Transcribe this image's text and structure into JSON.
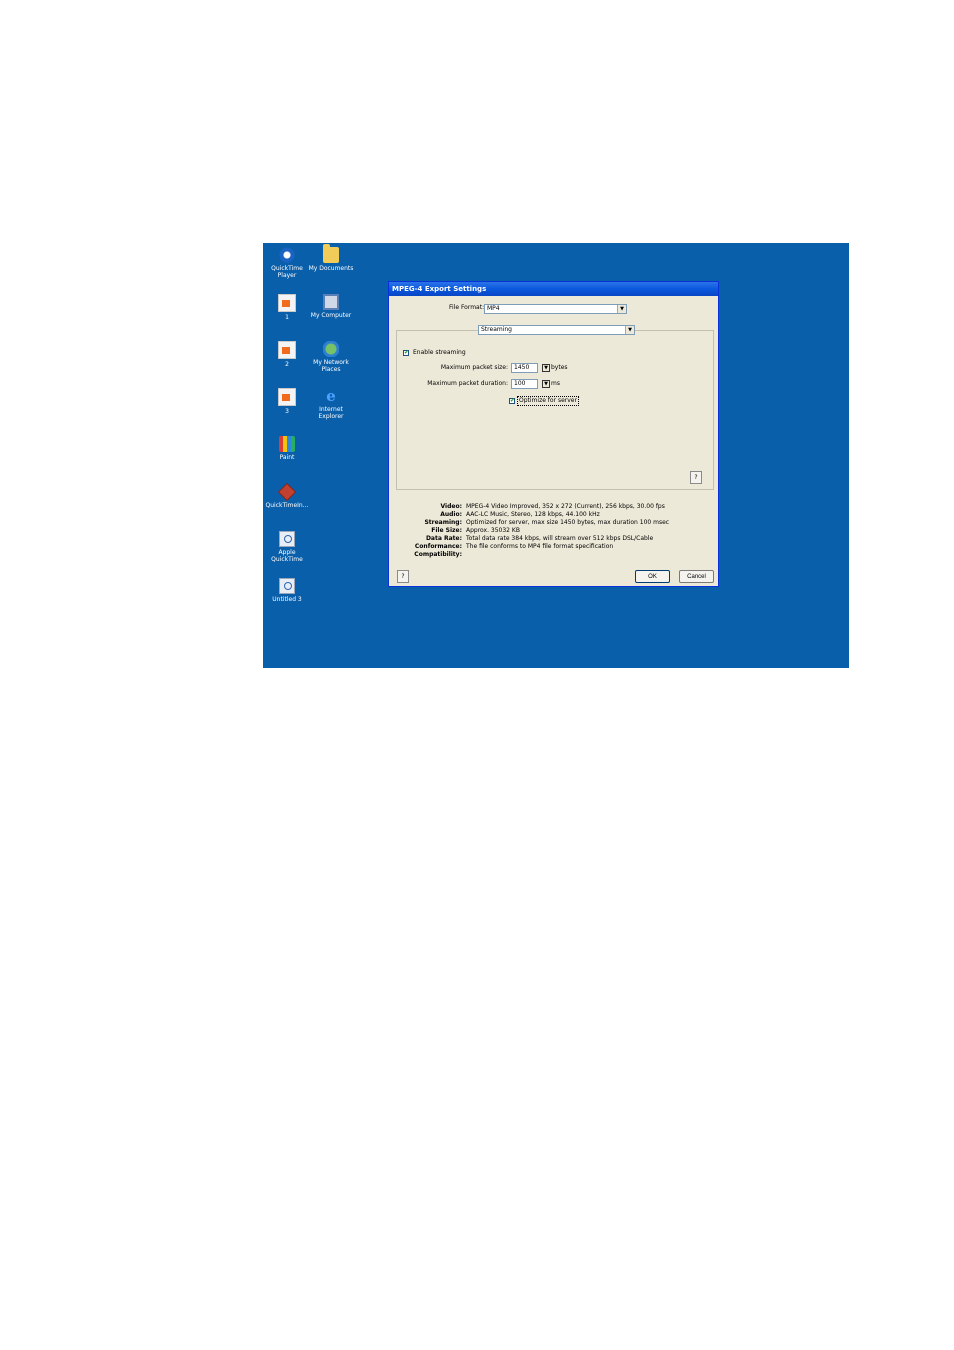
{
  "desktop_icons": [
    {
      "label": "QuickTime Player",
      "icon": "quicktime-player-icon"
    },
    {
      "label": "My Documents",
      "icon": "folder-icon"
    },
    {
      "label": "1",
      "icon": "document-icon"
    },
    {
      "label": "My Computer",
      "icon": "computer-icon"
    },
    {
      "label": "2",
      "icon": "document-icon"
    },
    {
      "label": "My Network Places",
      "icon": "network-places-icon"
    },
    {
      "label": "3",
      "icon": "document-icon"
    },
    {
      "label": "Internet Explorer",
      "icon": "internet-explorer-icon"
    },
    {
      "label": "Paint",
      "icon": "paint-icon"
    },
    {
      "label": "QuickTimeIn...",
      "icon": "installer-icon"
    },
    {
      "label": "Apple QuickTime",
      "icon": "quicktime-movie-icon"
    },
    {
      "label": "Untitled 3",
      "icon": "quicktime-movie-icon"
    }
  ],
  "dialog": {
    "title": "MPEG-4 Export Settings",
    "file_format_label": "File Format:",
    "file_format_value": "MP4",
    "section_value": "Streaming",
    "enable_streaming_label": "Enable streaming",
    "max_packet_size_label": "Maximum packet size:",
    "max_packet_size_value": "1450",
    "max_packet_size_unit": "bytes",
    "max_packet_duration_label": "Maximum packet duration:",
    "max_packet_duration_value": "100",
    "max_packet_duration_unit": "ms",
    "optimize_label": "Optimize for server",
    "help_label": "?",
    "summary": [
      {
        "label": "Video:",
        "value": "MPEG-4 Video Improved, 352 x 272 (Current), 256 kbps, 30.00 fps"
      },
      {
        "label": "Audio:",
        "value": "AAC-LC Music, Stereo, 128 kbps, 44.100 kHz"
      },
      {
        "label": "Streaming:",
        "value": "Optimized for server, max size 1450 bytes, max duration 100 msec"
      },
      {
        "label": "File Size:",
        "value": "Approx. 35032 KB"
      },
      {
        "label": "Data Rate:",
        "value": "Total data rate 384 kbps, will stream over 512 kbps DSL/Cable"
      },
      {
        "label": "Conformance:",
        "value": "The file conforms to MP4 file format specification"
      },
      {
        "label": "Compatibility:",
        "value": ""
      }
    ],
    "ok_label": "OK",
    "cancel_label": "Cancel"
  },
  "colors": {
    "desktop": "#0a5fab",
    "titlebar": "#0a58de",
    "dialog_bg": "#ece9d8"
  }
}
